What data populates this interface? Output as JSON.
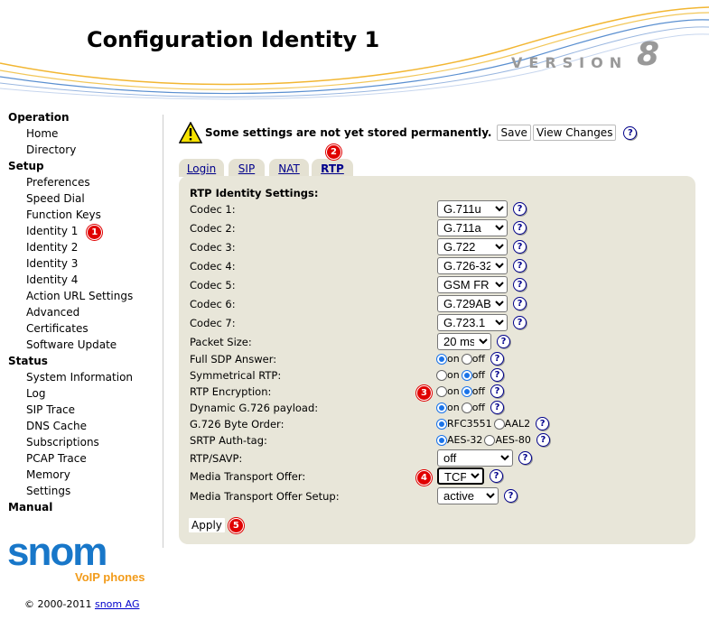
{
  "header": {
    "title": "Configuration Identity 1",
    "version_label": "VERSION",
    "version_number": "8"
  },
  "sidebar": {
    "sections": [
      {
        "label": "Operation",
        "items": [
          "Home",
          "Directory"
        ]
      },
      {
        "label": "Setup",
        "items": [
          "Preferences",
          "Speed Dial",
          "Function Keys",
          "Identity 1",
          "Identity 2",
          "Identity 3",
          "Identity 4",
          "Action URL Settings",
          "Advanced",
          "Certificates",
          "Software Update"
        ]
      },
      {
        "label": "Status",
        "items": [
          "System Information",
          "Log",
          "SIP Trace",
          "DNS Cache",
          "Subscriptions",
          "PCAP Trace",
          "Memory",
          "Settings"
        ]
      },
      {
        "label": "Manual",
        "items": []
      }
    ]
  },
  "logo": {
    "brand": "snom",
    "tagline": "VoIP phones"
  },
  "footer": {
    "copyright": "© 2000-2011",
    "company": "snom AG"
  },
  "warning": {
    "message": "Some settings are not yet stored permanently.",
    "save_label": "Save",
    "view_changes_label": "View Changes"
  },
  "tabs": [
    "Login",
    "SIP",
    "NAT",
    "RTP"
  ],
  "active_tab": "RTP",
  "badges": [
    "1",
    "2",
    "3",
    "4",
    "5"
  ],
  "form": {
    "heading": "RTP Identity Settings:",
    "codecs": [
      {
        "label": "Codec 1:",
        "value": "G.711u"
      },
      {
        "label": "Codec 2:",
        "value": "G.711a"
      },
      {
        "label": "Codec 3:",
        "value": "G.722"
      },
      {
        "label": "Codec 4:",
        "value": "G.726-32"
      },
      {
        "label": "Codec 5:",
        "value": "GSM FR"
      },
      {
        "label": "Codec 6:",
        "value": "G.729AB"
      },
      {
        "label": "Codec 7:",
        "value": "G.723.1"
      }
    ],
    "packet_size": {
      "label": "Packet Size:",
      "value": "20 ms"
    },
    "full_sdp": {
      "label": "Full SDP Answer:",
      "options": [
        "on",
        "off"
      ],
      "selected": "on"
    },
    "symmetrical_rtp": {
      "label": "Symmetrical RTP:",
      "options": [
        "on",
        "off"
      ],
      "selected": "off"
    },
    "rtp_encryption": {
      "label": "RTP Encryption:",
      "options": [
        "on",
        "off"
      ],
      "selected": "off"
    },
    "dynamic_g726": {
      "label": "Dynamic G.726 payload:",
      "options": [
        "on",
        "off"
      ],
      "selected": "on"
    },
    "g726_byte_order": {
      "label": "G.726 Byte Order:",
      "options": [
        "RFC3551",
        "AAL2"
      ],
      "selected": "RFC3551"
    },
    "srtp_auth_tag": {
      "label": "SRTP Auth-tag:",
      "options": [
        "AES-32",
        "AES-80"
      ],
      "selected": "AES-32"
    },
    "rtp_savp": {
      "label": "RTP/SAVP:",
      "value": "off"
    },
    "media_transport_offer": {
      "label": "Media Transport Offer:",
      "value": "TCP"
    },
    "media_transport_offer_setup": {
      "label": "Media Transport Offer Setup:",
      "value": "active"
    },
    "apply_label": "Apply"
  },
  "help_glyph": "?",
  "colors": {
    "panel": "#e8e6d9",
    "badge": "#e00000",
    "link": "#00008b",
    "logo_blue": "#1877c9",
    "logo_orange": "#f29b1a"
  }
}
